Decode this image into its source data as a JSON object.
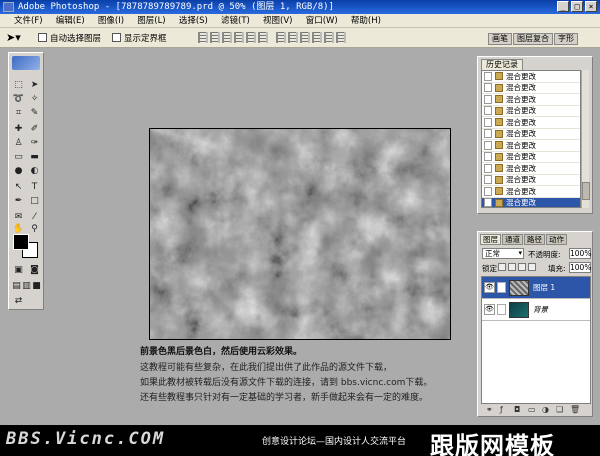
{
  "window": {
    "title": "Adobe Photoshop - [7878789789789.prd @ 50% (图层 1, RGB/8)]",
    "min": "_",
    "max": "□",
    "close": "×"
  },
  "menu": [
    "文件(F)",
    "编辑(E)",
    "图像(I)",
    "图层(L)",
    "选择(S)",
    "滤镜(T)",
    "视图(V)",
    "窗口(W)",
    "帮助(H)"
  ],
  "options": {
    "auto_select": "自动选择图层",
    "show_bounds": "显示定界框",
    "tabs": [
      "画笔",
      "图层复合",
      "字形"
    ]
  },
  "history": {
    "tab": "历史记录",
    "items": [
      "混合更改",
      "混合更改",
      "混合更改",
      "混合更改",
      "混合更改",
      "混合更改",
      "混合更改",
      "混合更改",
      "混合更改",
      "混合更改",
      "混合更改",
      "混合更改"
    ],
    "selected_index": 11
  },
  "layers": {
    "tabs": [
      "图层",
      "通道",
      "路径",
      "动作"
    ],
    "blend_mode": "正常",
    "opacity_label": "不透明度:",
    "opacity": "100%",
    "lock_label": "锁定:",
    "fill_label": "填充:",
    "fill": "100%",
    "items": [
      {
        "name": "图层 1",
        "selected": true
      },
      {
        "name": "背景",
        "selected": false
      }
    ]
  },
  "caption": {
    "line1": "前景色黑后景色白，然后使用云彩效果。",
    "line2": "这教程可能有些复杂，在此我们提出供了此作品的源文件下载，",
    "line3": "如果此教材被转载后没有源文件下载的连接，请到 bbs.vicnc.com下载。",
    "line4": "还有些教程事只针对有一定基础的学习者，新手做起来会有一定的难度。"
  },
  "footer": {
    "site": "BBS.Vicnc.COM",
    "tagline": "创意设计论坛—国内设计人交流平台",
    "brand": "跟版网模板"
  }
}
